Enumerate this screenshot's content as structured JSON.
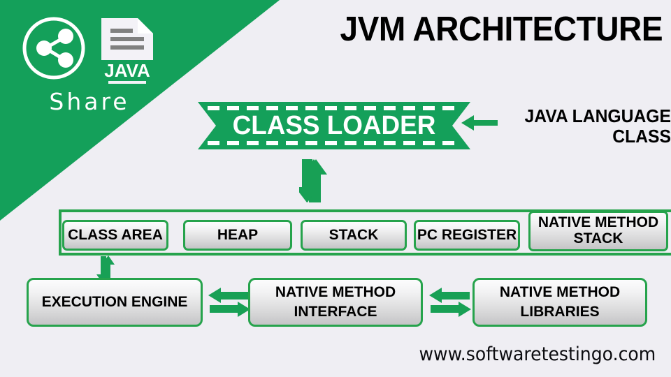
{
  "theme": {
    "green": "#14a05a",
    "border_green": "#26a34c",
    "background": "#efeef3",
    "text_dark": "#000000",
    "text_light": "#ffffff",
    "doc_line_gray": "#808080"
  },
  "brand": {
    "share_icon": "share-nodes-icon",
    "file_icon": "java-file-icon",
    "file_label": "JAVA",
    "share_label": "Share"
  },
  "header": {
    "title": "JVM ARCHITECTURE"
  },
  "class_loader": {
    "label": "CLASS LOADER",
    "ribbon_fill": "#14a05a",
    "dash_color": "#ffffff"
  },
  "callout": {
    "arrow_icon": "arrow-left-icon",
    "line1": "JAVA LANGUAGE",
    "line2": "CLASS"
  },
  "connectors": {
    "loader_to_memory": "double-arrow-vertical-icon",
    "class_area_to_engine": "double-arrow-vertical-icon",
    "engine_to_interface": "double-arrow-horizontal-icon",
    "interface_to_libraries": "double-arrow-horizontal-icon"
  },
  "memory_area": {
    "name": "runtime-data-areas",
    "boxes": [
      {
        "label": "CLASS AREA"
      },
      {
        "label": "HEAP"
      },
      {
        "label": "STACK"
      },
      {
        "label": "PC REGISTER"
      },
      {
        "label": "NATIVE METHOD STACK"
      }
    ]
  },
  "execution_row": {
    "boxes": [
      {
        "label": "EXECUTION ENGINE"
      },
      {
        "label": "NATIVE METHOD INTERFACE"
      },
      {
        "label": "NATIVE METHOD LIBRARIES"
      }
    ]
  },
  "footer": {
    "url": "www.softwaretestingo.com"
  }
}
